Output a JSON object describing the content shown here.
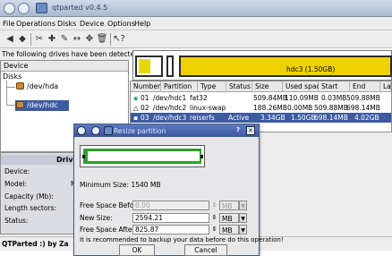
{
  "window": {
    "title": "qtparted v0.4.5"
  },
  "menu": [
    "File",
    "Operations",
    "Disks",
    "Device",
    "Options",
    "Help"
  ],
  "toolbar_icons": [
    "undo-icon",
    "redo-icon",
    "cut-icon",
    "create-icon",
    "edit-icon",
    "move-icon",
    "resize-icon",
    "delete-icon",
    "whatsthis-icon"
  ],
  "left": {
    "detected_text": "The following drives have been detected:",
    "device_header": "Device",
    "tree_root": "Disks",
    "drives": [
      "/dev/hda",
      "/dev/hdc"
    ],
    "drive_panel_title": "Drive",
    "drive_labels": [
      "Device:",
      "Model:",
      "Capacity (Mb):",
      "Length sectors:",
      "Status:"
    ],
    "drive_model_value": "M"
  },
  "partmap": {
    "label": "hdc3 (1.50GB)"
  },
  "ptable": {
    "headers": [
      "Number",
      "Partition",
      "Type",
      "Status",
      "Size",
      "Used space",
      "Start",
      "End",
      "La"
    ],
    "rows": [
      [
        "01",
        "/dev/hdc1",
        "fat32",
        "",
        "509.84MB",
        "110.09MB",
        "0.03MB",
        "509.88MB"
      ],
      [
        "02",
        "/dev/hdc2",
        "linux-swap",
        "",
        "188.26MB",
        "0.00MB",
        "509.88MB",
        "698.14MB"
      ],
      [
        "03",
        "/dev/hdc3",
        "reiserfs",
        "Active",
        "3.34GB",
        "1.50GB",
        "698.14MB",
        "4.02GB"
      ]
    ]
  },
  "status": {
    "text": "QTParted :)  by Za"
  },
  "dialog": {
    "title": "Resize partition",
    "help_glyph": "?",
    "close_glyph": "✕",
    "min_size": "Minimum Size: 1540 MB",
    "free_before_label": "Free Space Before:",
    "free_before_value": "0.00",
    "new_size_label": "New Size:",
    "new_size_value": "2594.21",
    "free_after_label": "Free Space After:",
    "free_after_value": "825.87",
    "unit": "MB",
    "warning": "It is recommended to backup your data before do this operation!",
    "ok_label": "OK",
    "cancel_label": "Cancel"
  },
  "colors": {
    "selection": "#3e5aa1",
    "partition_yellow": "#f0d100",
    "resize_green": "#2e9e2e",
    "dialog_title": "#3b57a0"
  }
}
